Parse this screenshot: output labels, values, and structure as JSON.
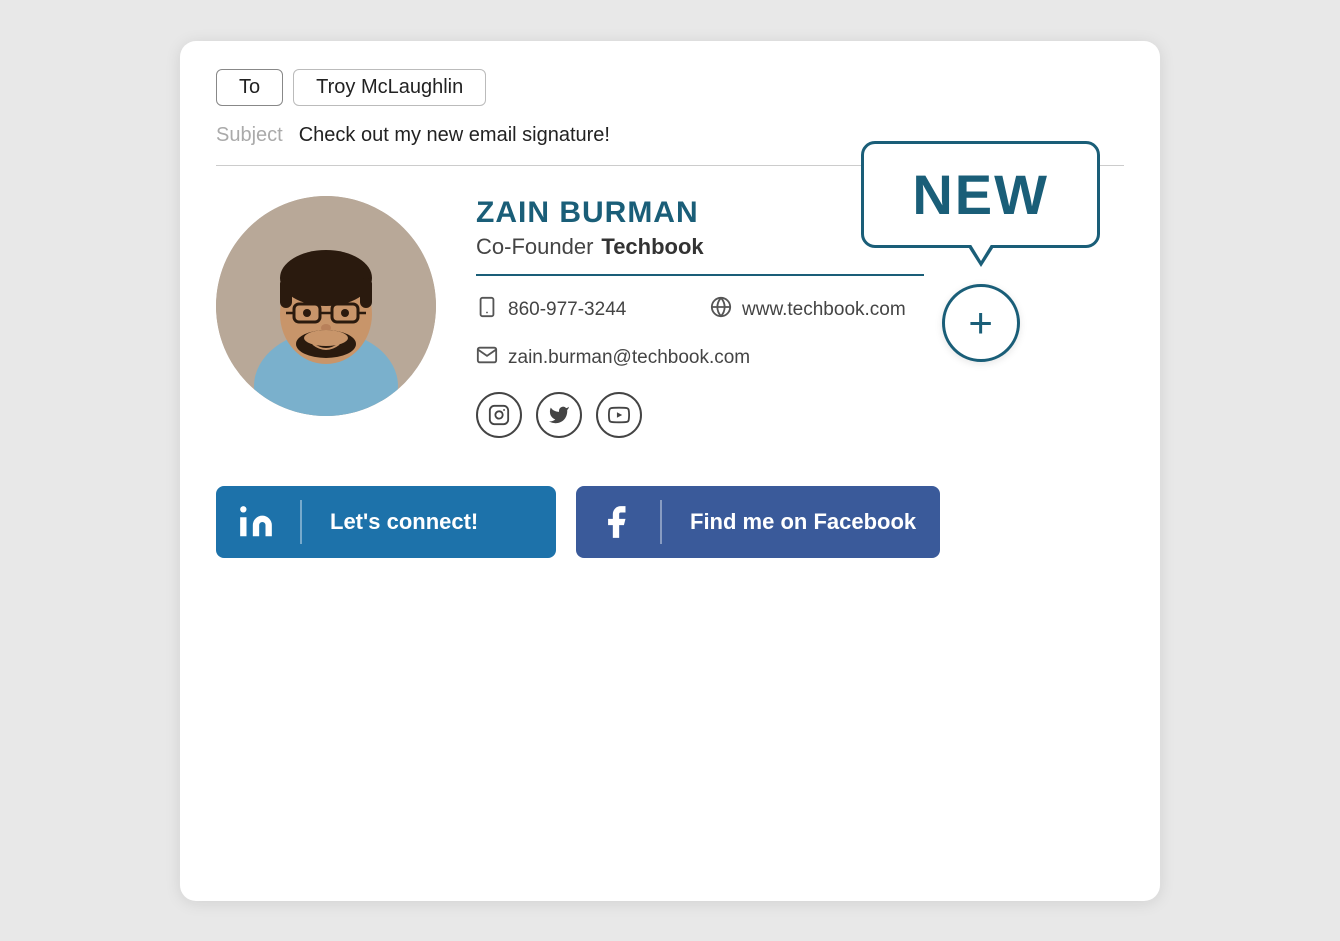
{
  "email": {
    "to_label": "To",
    "recipient": "Troy McLaughlin",
    "subject_label": "Subject",
    "subject_text": "Check out my new email signature!"
  },
  "new_badge": {
    "text": "NEW"
  },
  "plus_button": {
    "symbol": "+"
  },
  "signature": {
    "name": "ZAIN BURMAN",
    "title": "Co-Founder",
    "company": "Techbook",
    "phone": "860-977-3244",
    "website": "www.techbook.com",
    "email": "zain.burman@techbook.com"
  },
  "social": {
    "icons": [
      "instagram-icon",
      "twitter-icon",
      "youtube-icon"
    ]
  },
  "cta": {
    "linkedin_label": "Let's connect!",
    "facebook_label": "Find me on Facebook"
  }
}
